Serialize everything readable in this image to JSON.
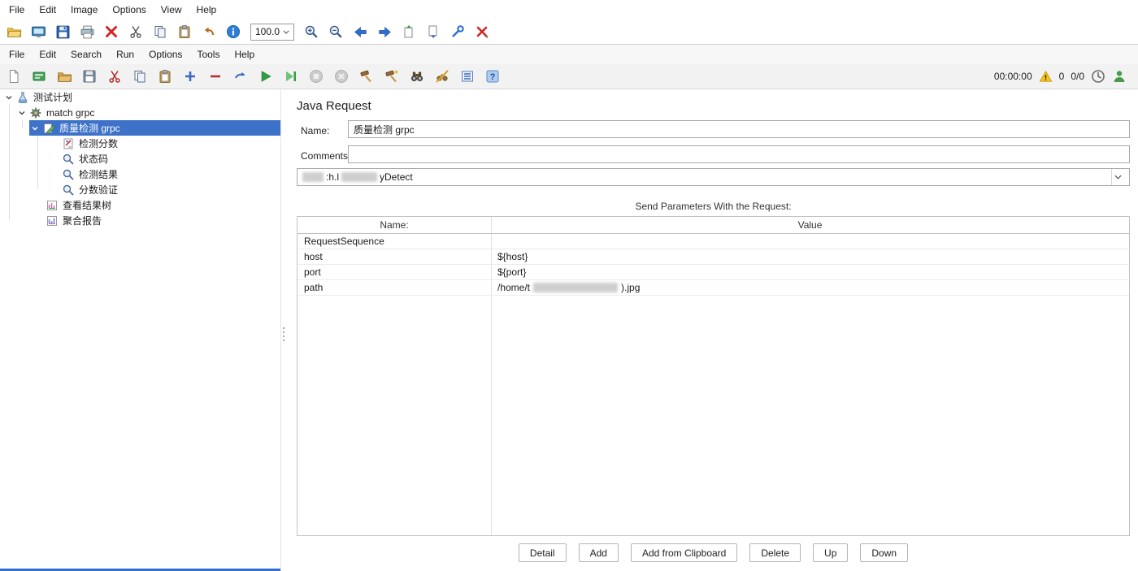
{
  "colors": {
    "selection_blue": "#3d72c8",
    "accent_blue": "#2f6fd0",
    "warning_yellow": "#f7c51e"
  },
  "viewer": {
    "menu": {
      "file": "File",
      "edit": "Edit",
      "image": "Image",
      "options": "Options",
      "view": "View",
      "help": "Help"
    },
    "zoom_value": "100.0"
  },
  "jm": {
    "menu": {
      "file": "File",
      "edit": "Edit",
      "search": "Search",
      "run": "Run",
      "options": "Options",
      "tools": "Tools",
      "help": "Help"
    },
    "status": {
      "timer": "00:00:00",
      "error_count": "0",
      "thread_count": "0/0"
    }
  },
  "tree": {
    "items": [
      {
        "label": "测试计划"
      },
      {
        "label": "match grpc"
      },
      {
        "label": "质量检测 grpc"
      },
      {
        "label": "检测分数"
      },
      {
        "label": "状态码"
      },
      {
        "label": "检测结果"
      },
      {
        "label": "分数验证"
      },
      {
        "label": "查看结果树"
      },
      {
        "label": "聚合报告"
      }
    ]
  },
  "main": {
    "title": "Java Request",
    "name_label": "Name:",
    "name_value": "质量检测 grpc",
    "comments_label": "Comments:",
    "comments_value": "",
    "classname": {
      "part1": ":h.l",
      "part2": "yDetect"
    },
    "params_caption": "Send Parameters With the Request:",
    "table": {
      "header_name": "Name:",
      "header_value": "Value",
      "rows": [
        {
          "name": "RequestSequence",
          "value": ""
        },
        {
          "name": "host",
          "value": "${host}"
        },
        {
          "name": "port",
          "value": "${port}"
        },
        {
          "name": "path",
          "value_start": "/home/t",
          "value_end": ").jpg"
        }
      ]
    },
    "buttons": {
      "detail": "Detail",
      "add": "Add",
      "add_from_clipboard": "Add from Clipboard",
      "delete": "Delete",
      "up": "Up",
      "down": "Down"
    }
  }
}
